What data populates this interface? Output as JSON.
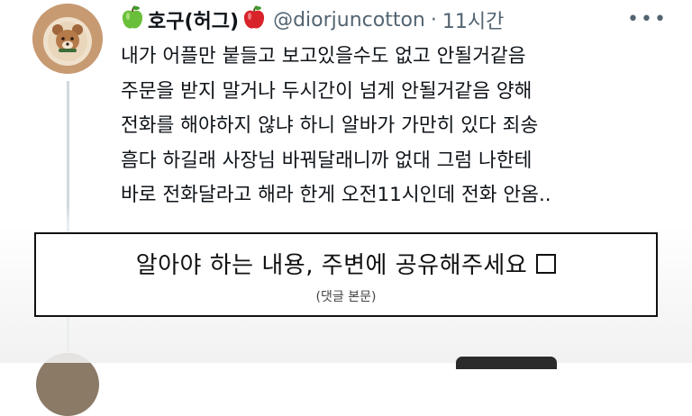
{
  "tweet": {
    "display_name": "호구(허그)",
    "name_emoji_left": "green-apple",
    "name_emoji_right": "red-apple",
    "handle": "@diorjuncotton",
    "separator": "·",
    "time": "11시간",
    "more_icon": "more-horizontal-icon",
    "lines": [
      "내가 어플만 붙들고 보고있을수도 없고 안될거같음",
      "주문을 받지 말거나 두시간이 넘게 안될거같음 양해",
      "전화를 해야하지 않냐 하니 알바가 가만히 있다 죄송",
      "흠다 하길래 사장님 바꿔달래니까 없대 그럼 나한테",
      "바로 전화달라고 해라 한게 오전11시인데 전화 안옴.."
    ]
  },
  "overlay": {
    "title": "알아야 하는 내용, 주변에 공유해주세요",
    "subtitle": "(댓글 본문)",
    "checkbox_icon": "empty-checkbox-icon"
  },
  "colors": {
    "text": "#0f1419",
    "secondary": "#536471",
    "apple_green": "#6abf3a",
    "apple_red": "#d8232a",
    "overlay_border": "#111111"
  }
}
